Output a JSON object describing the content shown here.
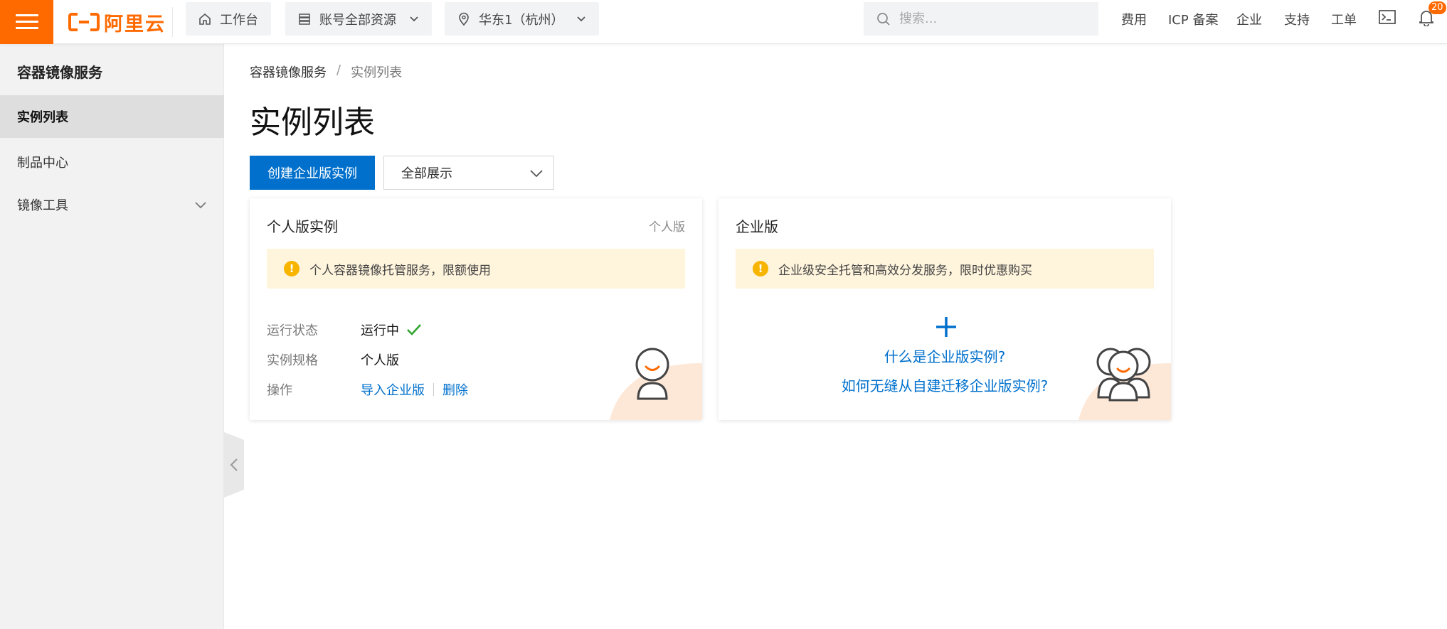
{
  "topbar": {
    "logo_text": "阿里云",
    "workbench": "工作台",
    "resources": "账号全部资源",
    "region": "华东1（杭州）",
    "search_placeholder": "搜索...",
    "nav": [
      "费用",
      "ICP 备案",
      "企业",
      "支持",
      "工单"
    ],
    "notification_count": "20",
    "brand_color": "#ff6a00"
  },
  "sidebar": {
    "title": "容器镜像服务",
    "items": [
      {
        "label": "实例列表",
        "active": true
      },
      {
        "label": "制品中心",
        "active": false
      },
      {
        "label": "镜像工具",
        "active": false,
        "expandable": true
      }
    ]
  },
  "breadcrumb": {
    "root": "容器镜像服务",
    "separator": "/",
    "current": "实例列表"
  },
  "page": {
    "title": "实例列表",
    "create_button": "创建企业版实例",
    "filter_select": "全部展示"
  },
  "personal_card": {
    "title": "个人版实例",
    "tag": "个人版",
    "notice": "个人容器镜像托管服务，限额使用",
    "status_label": "运行状态",
    "status_value": "运行中",
    "spec_label": "实例规格",
    "spec_value": "个人版",
    "ops_label": "操作",
    "op_upgrade": "导入企业版",
    "op_delete": "删除"
  },
  "enterprise_card": {
    "title": "企业版",
    "notice": "企业级安全托管和高效分发服务，限时优惠购买",
    "link_what": "什么是企业版实例?",
    "link_migrate": "如何无缝从自建迁移企业版实例?"
  },
  "colors": {
    "primary": "#0070cc",
    "accent": "#ff6a00",
    "notice_bg": "#fff4dc",
    "success": "#2fa52f"
  }
}
